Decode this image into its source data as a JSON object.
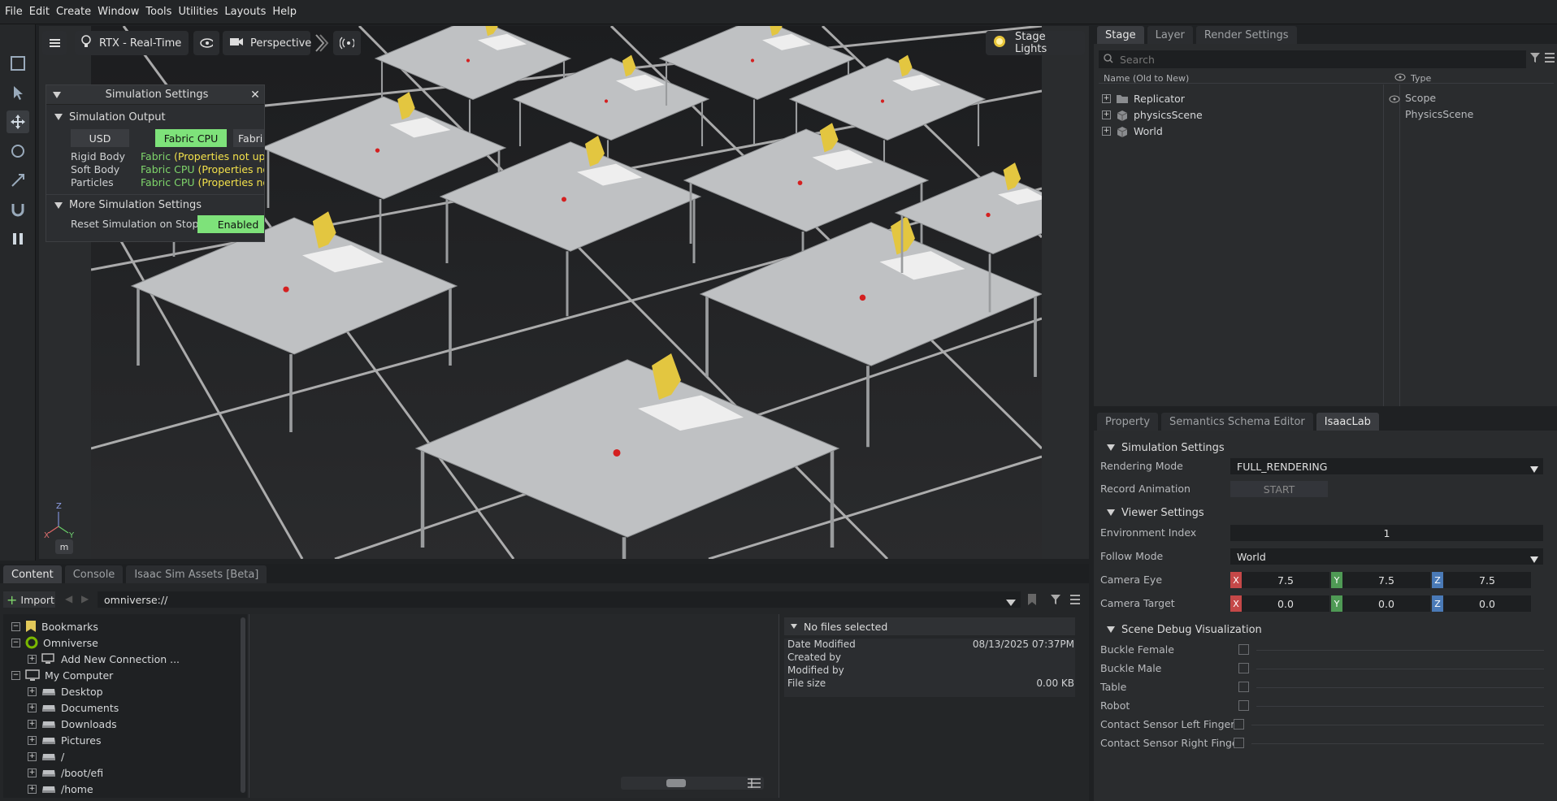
{
  "menu": [
    "File",
    "Edit",
    "Create",
    "Window",
    "Tools",
    "Utilities",
    "Layouts",
    "Help"
  ],
  "viewport": {
    "rtx_label": "RTX - Real-Time",
    "camera_label": "Perspective",
    "lights_label": "Stage Lights",
    "axis_labels": {
      "z": "Z",
      "x": "X",
      "y": "Y"
    },
    "m_button": "m"
  },
  "sim_settings": {
    "title": "Simulation Settings",
    "output_section": "Simulation Output",
    "buttons": [
      "USD",
      "Fabric CPU",
      "Fabri"
    ],
    "rows": [
      {
        "label": "Rigid Body",
        "value_prefix": "Fabric",
        "value_rest": " (Properties not upda"
      },
      {
        "label": "Soft Body",
        "value_prefix": "Fabric CPU",
        "value_rest": " (Properties not u"
      },
      {
        "label": "Particles",
        "value_prefix": "Fabric CPU",
        "value_rest": " (Properties not u"
      }
    ],
    "more_section": "More Simulation Settings",
    "reset_label": "Reset Simulation on Stop",
    "reset_value": "Enabled"
  },
  "stage": {
    "tabs": [
      "Stage",
      "Layer",
      "Render Settings"
    ],
    "search_placeholder": "Search",
    "col_name": "Name (Old to New)",
    "col_type": "Type",
    "items": [
      {
        "name": "Replicator",
        "type": "Scope"
      },
      {
        "name": "physicsScene",
        "type": "PhysicsScene"
      },
      {
        "name": "World",
        "type": ""
      }
    ]
  },
  "props": {
    "tabs": [
      "Property",
      "Semantics Schema Editor",
      "IsaacLab"
    ],
    "sim_section": "Simulation Settings",
    "rendering_mode_label": "Rendering Mode",
    "rendering_mode_value": "FULL_RENDERING",
    "record_label": "Record Animation",
    "record_button": "START",
    "viewer_section": "Viewer Settings",
    "env_index_label": "Environment Index",
    "env_index_value": "1",
    "follow_label": "Follow Mode",
    "follow_value": "World",
    "cam_eye_label": "Camera Eye",
    "cam_eye": [
      "7.5",
      "7.5",
      "7.5"
    ],
    "cam_target_label": "Camera Target",
    "cam_target": [
      "0.0",
      "0.0",
      "0.0"
    ],
    "axes": [
      "X",
      "Y",
      "Z"
    ],
    "debug_section": "Scene Debug Visualization",
    "debug_items": [
      "Buckle Female",
      "Buckle Male",
      "Table",
      "Robot",
      "Contact Sensor Left Finger",
      "Contact Sensor Right Finger"
    ]
  },
  "content": {
    "tabs": [
      "Content",
      "Console",
      "Isaac Sim Assets [Beta]"
    ],
    "import_label": "Import",
    "path": "omniverse://",
    "tree": [
      {
        "label": "Bookmarks",
        "indent": 0
      },
      {
        "label": "Omniverse",
        "indent": 0
      },
      {
        "label": "Add New Connection ...",
        "indent": 1
      },
      {
        "label": "My Computer",
        "indent": 0
      },
      {
        "label": "Desktop",
        "indent": 1
      },
      {
        "label": "Documents",
        "indent": 1
      },
      {
        "label": "Downloads",
        "indent": 1
      },
      {
        "label": "Pictures",
        "indent": 1
      },
      {
        "label": "/",
        "indent": 1
      },
      {
        "label": "/boot/efi",
        "indent": 1
      },
      {
        "label": "/home",
        "indent": 1
      }
    ],
    "details_title": "No files selected",
    "date_label": "Date Modified",
    "date_value": "08/13/2025 07:37PM",
    "created_label": "Created by",
    "modified_label": "Modified by",
    "size_label": "File size",
    "size_value": "0.00 KB"
  }
}
